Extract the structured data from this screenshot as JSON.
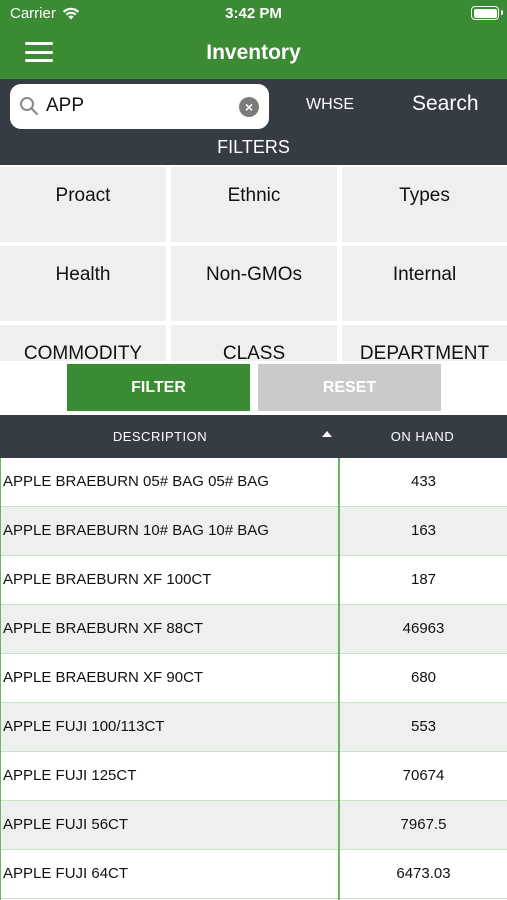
{
  "status_bar": {
    "carrier": "Carrier",
    "time": "3:42 PM"
  },
  "header": {
    "title": "Inventory"
  },
  "search": {
    "value": "APP",
    "whse_label": "WHSE",
    "search_label": "Search",
    "filters_label": "FILTERS"
  },
  "filters": {
    "row1": [
      "Proact",
      "Ethnic",
      "Types"
    ],
    "row2": [
      "Health",
      "Non-GMOs",
      "Internal"
    ],
    "row3": [
      "COMMODITY",
      "CLASS",
      "DEPARTMENT"
    ]
  },
  "actions": {
    "filter_label": "FILTER",
    "reset_label": "RESET"
  },
  "table": {
    "col_description": "DESCRIPTION",
    "col_onhand": "ON HAND",
    "sort_direction": "ascending",
    "rows": [
      {
        "description": "APPLE BRAEBURN 05# BAG 05# BAG",
        "on_hand": "433"
      },
      {
        "description": "APPLE BRAEBURN 10# BAG 10# BAG",
        "on_hand": "163"
      },
      {
        "description": "APPLE BRAEBURN XF 100CT",
        "on_hand": "187"
      },
      {
        "description": "APPLE BRAEBURN XF 88CT",
        "on_hand": "46963"
      },
      {
        "description": "APPLE BRAEBURN XF 90CT",
        "on_hand": "680"
      },
      {
        "description": "APPLE FUJI 100/113CT",
        "on_hand": "553"
      },
      {
        "description": "APPLE FUJI 125CT",
        "on_hand": "70674"
      },
      {
        "description": "APPLE FUJI 56CT",
        "on_hand": "7967.5"
      },
      {
        "description": "APPLE FUJI 64CT",
        "on_hand": "6473.03"
      }
    ]
  },
  "colors": {
    "brand_green": "#3b8a34",
    "dark_bar": "#363c44",
    "cell_bg": "#eef0f0",
    "row_alt": "#eef0f0",
    "reset_gray": "#c8cacc"
  }
}
